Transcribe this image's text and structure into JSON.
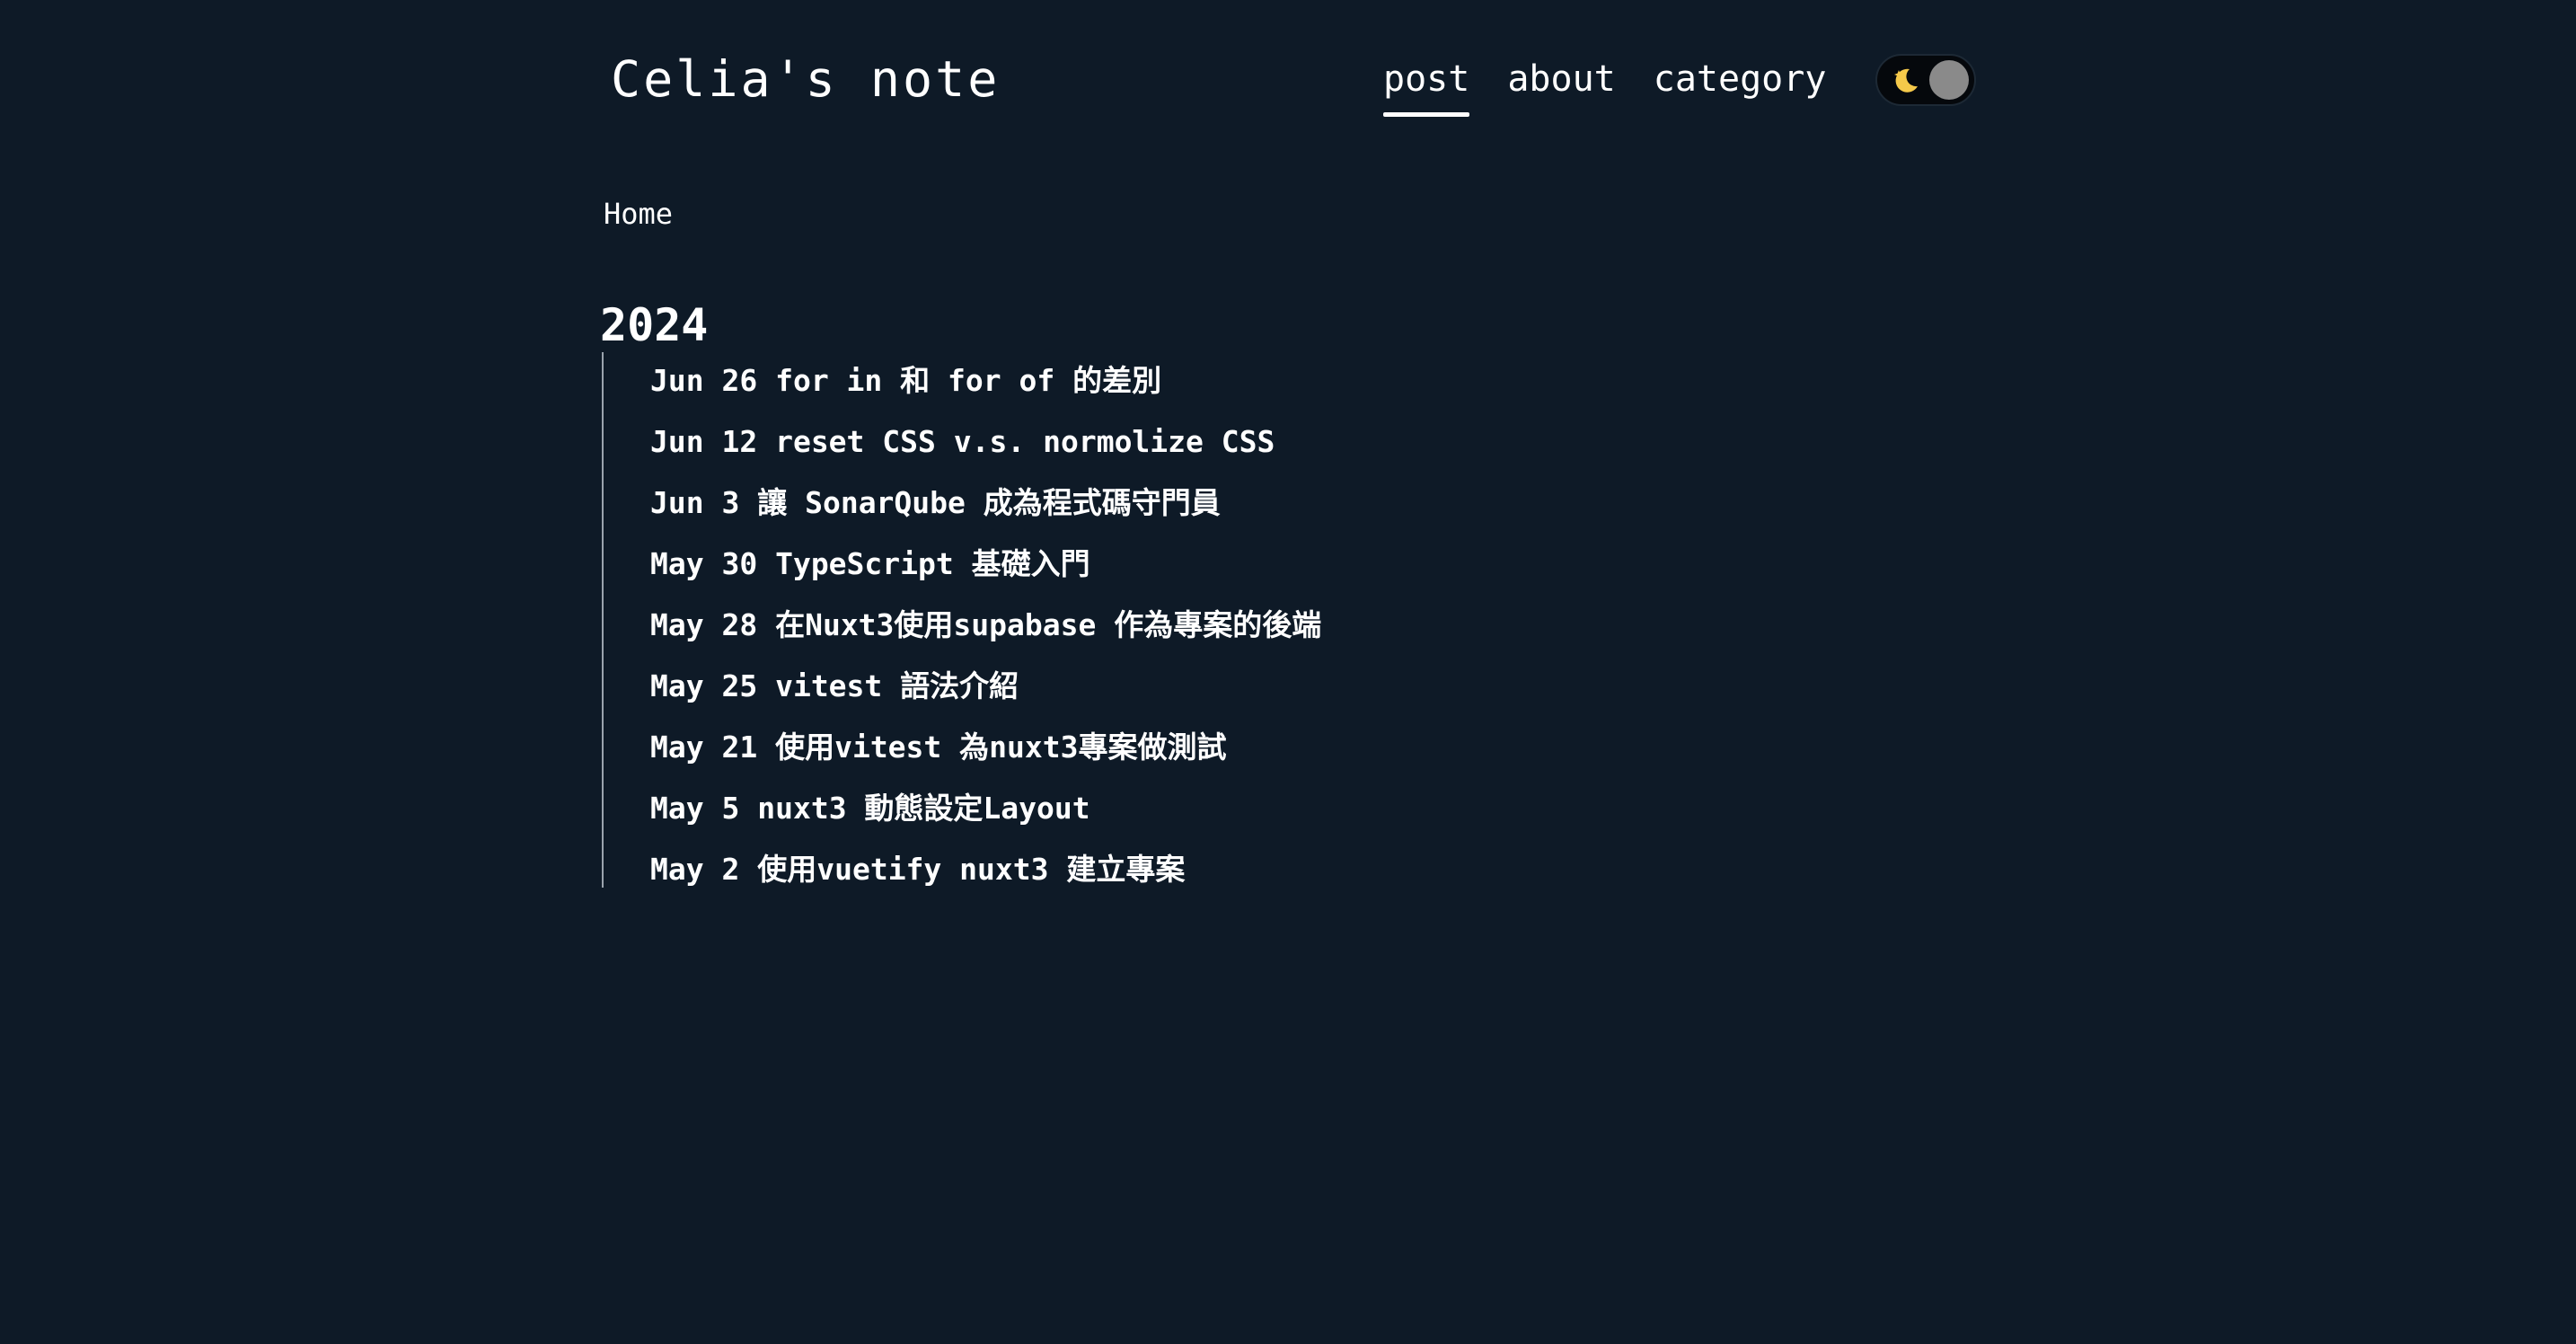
{
  "site": {
    "title": "Celia's note"
  },
  "nav": {
    "items": [
      {
        "label": "post",
        "active": true
      },
      {
        "label": "about",
        "active": false
      },
      {
        "label": "category",
        "active": false
      }
    ]
  },
  "theme_toggle": {
    "icon": "moon-star-icon",
    "mode": "dark"
  },
  "breadcrumb": {
    "label": "Home"
  },
  "archive": {
    "year": "2024",
    "posts": [
      {
        "date": "Jun 26",
        "title": "for in 和 for of 的差別"
      },
      {
        "date": "Jun 12",
        "title": "reset CSS v.s. normolize CSS"
      },
      {
        "date": "Jun 3",
        "title": "讓 SonarQube 成為程式碼守門員"
      },
      {
        "date": "May 30",
        "title": "TypeScript 基礎入門"
      },
      {
        "date": "May 28",
        "title": "在Nuxt3使用supabase 作為專案的後端"
      },
      {
        "date": "May 25",
        "title": "vitest 語法介紹"
      },
      {
        "date": "May 21",
        "title": "使用vitest 為nuxt3專案做測試"
      },
      {
        "date": "May 5",
        "title": "nuxt3 動態設定Layout"
      },
      {
        "date": "May 2",
        "title": "使用vuetify nuxt3 建立專案"
      }
    ]
  },
  "colors": {
    "background": "#0e1a27",
    "text": "#ffffff",
    "timeline": "#9aa3ad",
    "toggle_knob": "#8a8a8a",
    "moon": "#f5c94a"
  }
}
